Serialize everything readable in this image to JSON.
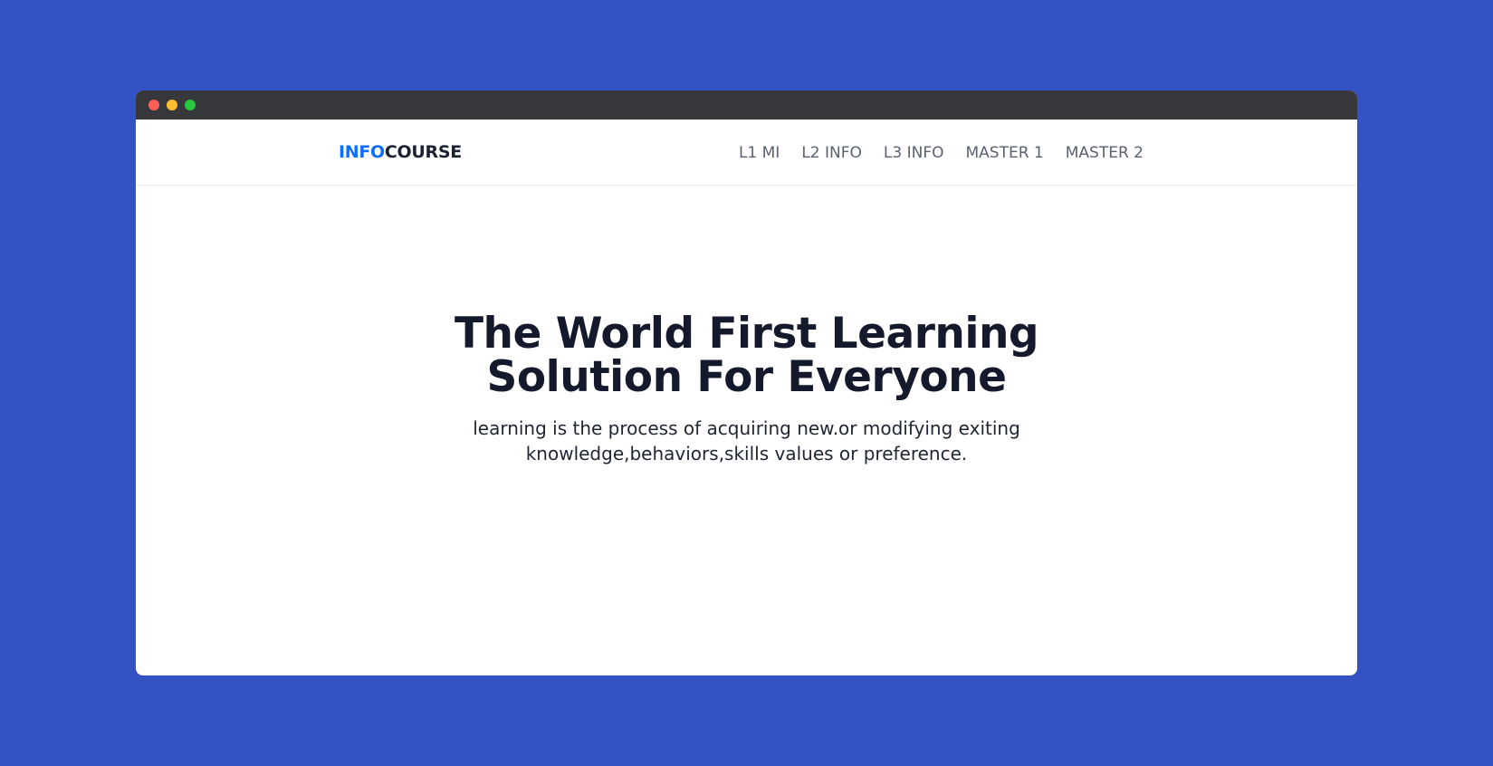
{
  "window": {
    "controls": {
      "close_color": "#ff5f57",
      "minimize_color": "#febc2e",
      "maximize_color": "#28c840"
    }
  },
  "navbar": {
    "brand_part1": "INFO",
    "brand_part2": "COURSE",
    "brand_color": "#0d6efd",
    "links": [
      {
        "label": "L1 MI"
      },
      {
        "label": "L2 INFO"
      },
      {
        "label": "L3 INFO"
      },
      {
        "label": "MASTER 1"
      },
      {
        "label": "MASTER 2"
      }
    ]
  },
  "hero": {
    "title": "The World First Learning Solution For Everyone",
    "subtitle": "learning is the process of acquiring new.or modifying exiting knowledge,behaviors,skills values or preference."
  },
  "colors": {
    "page_background": "#3453c2",
    "titlebar": "#37383b",
    "heading": "#141a2b"
  }
}
